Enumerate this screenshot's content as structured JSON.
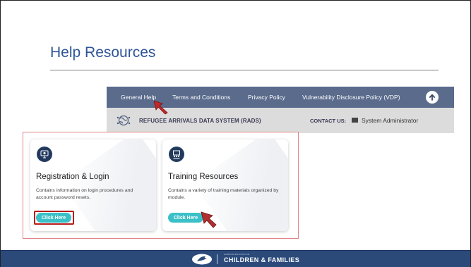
{
  "slide": {
    "title": "Help Resources"
  },
  "rads_nav": {
    "items": [
      "General Help",
      "Terms and Conditions",
      "Privacy Policy",
      "Vulnerability Disclosure Policy (VDP)"
    ],
    "up_icon": "arrow-up-circle-icon"
  },
  "rads_header": {
    "system_name": "REFUGEE ARRIVALS DATA SYSTEM (RADS)",
    "contact_label": "CONTACT US:",
    "contact_name": "System Administrator"
  },
  "cards": [
    {
      "icon": "computer-login-icon",
      "title": "Registration & Login",
      "description": "Contains information on login procedures and account password resets.",
      "button": "Click Here"
    },
    {
      "icon": "training-presentation-icon",
      "title": "Training Resources",
      "description": "Contains a variety of training materials organized by module.",
      "button": "Click Here"
    }
  ],
  "footer": {
    "admin_line": "ADMINISTRATION FOR",
    "org_name": "CHILDREN & FAMILIES"
  },
  "colors": {
    "title_blue": "#2f5597",
    "nav_bg": "#5a6b8c",
    "button_teal": "#3cc0c7",
    "highlight_red": "#b71c1c",
    "footer_navy": "#2b4a7a"
  }
}
